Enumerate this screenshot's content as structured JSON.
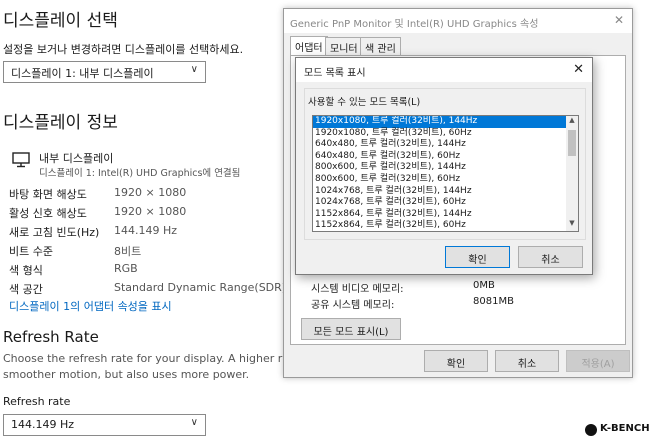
{
  "settings": {
    "display_select": {
      "heading": "디스플레이 선택",
      "instruction": "설정을 보거나 변경하려면 디스플레이를 선택하세요.",
      "dropdown_value": "디스플레이 1: 내부 디스플레이"
    },
    "display_info": {
      "heading": "디스플레이 정보",
      "monitor_name": "내부 디스플레이",
      "monitor_connection": "디스플레이 1: Intel(R) UHD Graphics에 연결됨",
      "rows": [
        {
          "label": "바탕 화면 해상도",
          "value": "1920 × 1080"
        },
        {
          "label": "활성 신호 해상도",
          "value": "1920 × 1080"
        },
        {
          "label": "새로 고침 빈도(Hz)",
          "value": "144.149 Hz"
        },
        {
          "label": "비트 수준",
          "value": "8비트"
        },
        {
          "label": "색 형식",
          "value": "RGB"
        },
        {
          "label": "색 공간",
          "value": "Standard Dynamic Range(SDR)"
        }
      ],
      "adapter_link": "디스플레이 1의 어댑터 속성을 표시"
    },
    "refresh": {
      "heading": "Refresh Rate",
      "description_line1": "Choose the refresh rate for your display. A higher rate provi",
      "description_line2": "smoother motion, but also uses more power.",
      "label": "Refresh rate",
      "dropdown_value": "144.149 Hz"
    }
  },
  "properties_window": {
    "title": "Generic PnP Monitor 및 Intel(R) UHD Graphics 속성",
    "tabs": [
      "어댑터",
      "모니터",
      "색 관리"
    ],
    "info_rows": [
      {
        "label": "시스템 비디오 메모리:",
        "value": "0MB"
      },
      {
        "label": "공유 시스템 메모리:",
        "value": "8081MB"
      }
    ],
    "list_all_modes_button": "모든 모드 표시(L)",
    "ok_button": "확인",
    "cancel_button": "취소",
    "apply_button": "적용(A)"
  },
  "mode_dialog": {
    "title": "모드 목록 표시",
    "group_label": "사용할 수 있는 모드 목록(L)",
    "modes": [
      "1920x1080, 트루 컬러(32비트), 144Hz",
      "1920x1080, 트루 컬러(32비트), 60Hz",
      "640x480, 트루 컬러(32비트), 144Hz",
      "640x480, 트루 컬러(32비트), 60Hz",
      "800x600, 트루 컬러(32비트), 144Hz",
      "800x600, 트루 컬러(32비트), 60Hz",
      "1024x768, 트루 컬러(32비트), 144Hz",
      "1024x768, 트루 컬러(32비트), 60Hz",
      "1152x864, 트루 컬러(32비트), 144Hz",
      "1152x864, 트루 컬러(32비트), 60Hz"
    ],
    "selected_index": 0,
    "ok_button": "확인",
    "cancel_button": "취소"
  },
  "watermark": {
    "text": "K-BENCH"
  },
  "colors": {
    "accent": "#0078d7",
    "link": "#0067c0"
  },
  "icons": [
    "monitor-icon",
    "chevron-down-icon",
    "close-icon",
    "scroll-up-icon",
    "scroll-down-icon"
  ]
}
